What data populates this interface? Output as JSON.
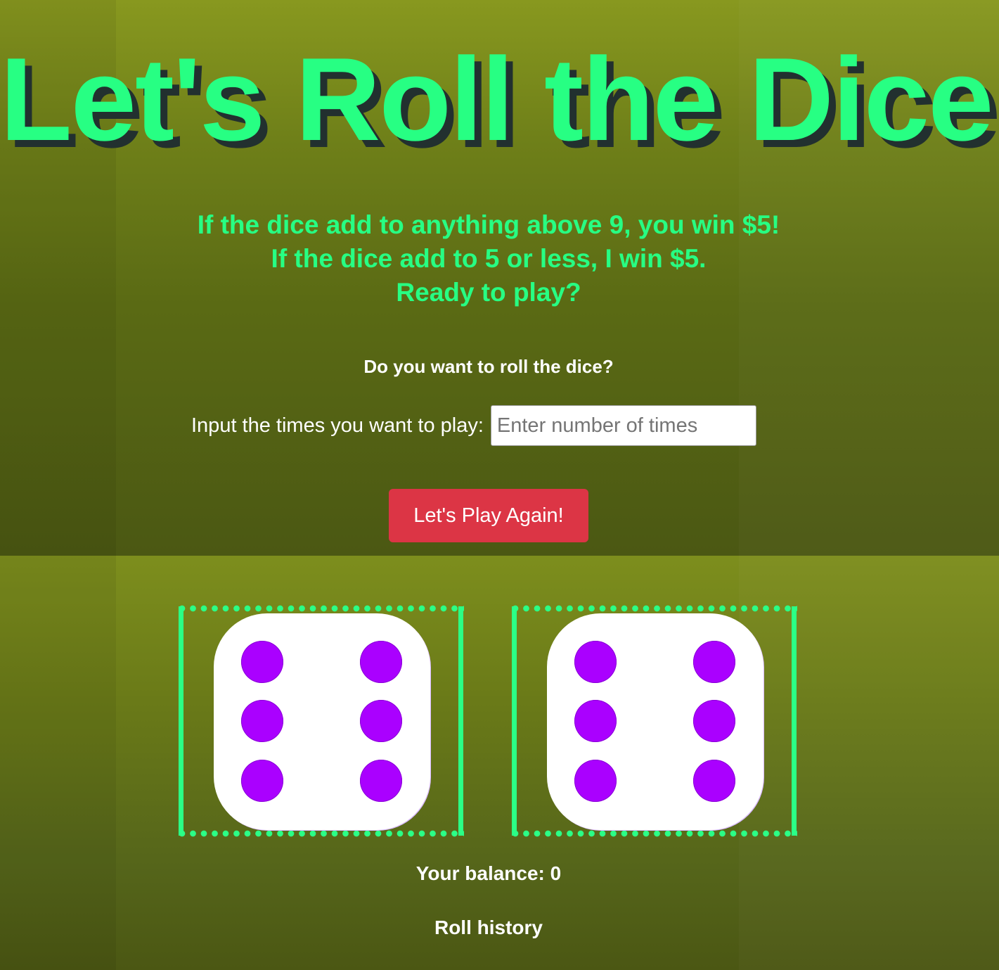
{
  "header": {
    "title": "Let's Roll the Dice!"
  },
  "rules": {
    "line1": "If the dice add to anything above 9, you win $5!",
    "line2": "If the dice add to 5 or less, I win $5.",
    "line3": "Ready to play?"
  },
  "prompt": {
    "question": "Do you want to roll the dice?",
    "input_label": "Input the times you want to play:",
    "input_placeholder": "Enter number of times",
    "input_value": ""
  },
  "play_button": {
    "label": "Let's Play Again!"
  },
  "dice": [
    {
      "value": 6
    },
    {
      "value": 6
    }
  ],
  "balance": {
    "text": "Your balance: 0"
  },
  "history": {
    "label": "Roll history"
  },
  "colors": {
    "accent_green": "#27ff83",
    "button_red": "#dc3545",
    "pip_purple": "#aa00ff",
    "background_olive": "#6a7a18"
  }
}
